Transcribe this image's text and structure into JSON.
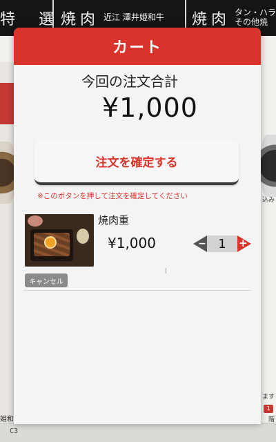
{
  "background": {
    "nav_tabs": [
      {
        "big": "特　選",
        "small": ""
      },
      {
        "big": "焼肉",
        "small": "近江 澤井姫和牛"
      },
      {
        "big": "焼肉",
        "small": "タン・ハラ\nその他焼"
      }
    ],
    "left_label": "姫和",
    "right_texts": [
      "込み",
      "ます",
      "1",
      "階"
    ],
    "footer_code": "C3"
  },
  "cart": {
    "title": "カート",
    "total_label": "今回の注文合計",
    "total_value": "¥1,000",
    "confirm_button": "注文を確定する",
    "confirm_note": "※このボタンを押して注文を確定してください",
    "items": [
      {
        "name": "焼肉重",
        "price": "¥1,000",
        "quantity": "1",
        "minus": "−",
        "plus": "+",
        "cancel": "キャンセル"
      }
    ]
  },
  "colors": {
    "accent": "#d9342b",
    "header_text": "#ffffff",
    "modal_bg": "#f4f4f4"
  }
}
